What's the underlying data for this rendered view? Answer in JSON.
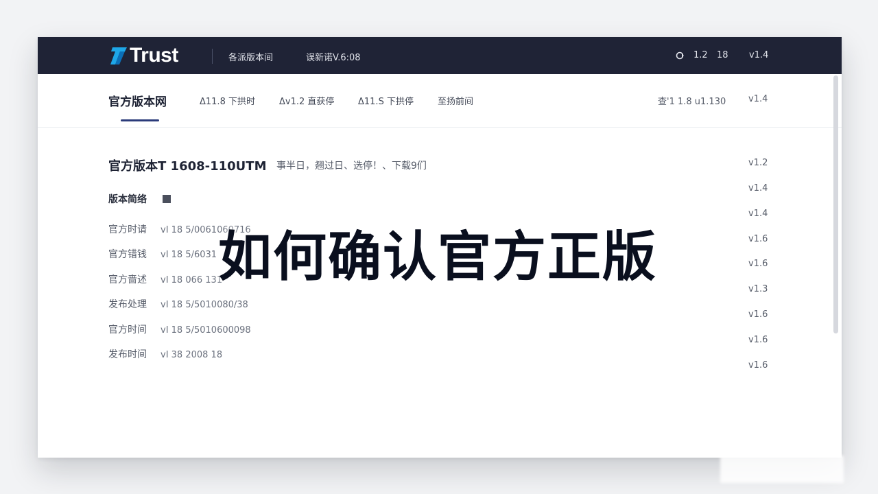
{
  "brand": {
    "name": "Trust"
  },
  "topbar": {
    "links": [
      "各派版本间",
      "误新诺V.6:08"
    ],
    "right": [
      "1.2",
      "18",
      "v1.4"
    ]
  },
  "subnav": {
    "title": "官方版本网",
    "tabs": [
      "Δ11.8 下拱时",
      "Δv1.2 直获停",
      "Δ11.S 下拱停",
      "至扬前间"
    ],
    "right": [
      "查'1 1.8  u1.130",
      "v1.4"
    ]
  },
  "content": {
    "title": "官方版本T 1608-110UTM",
    "subtitle": "事半日，翘过日、选停！、下载9们",
    "section_label": "版本简络",
    "rows": [
      {
        "key": "官方时请",
        "value": "vI 18 5/0061060716"
      },
      {
        "key": "官方错钱",
        "value": "vI 18 5/6031"
      },
      {
        "key": "官方啬述",
        "value": "vI 18 066 131"
      },
      {
        "key": "发布处理",
        "value": "vI 18 5/5010080/38"
      },
      {
        "key": "官方时间",
        "value": "vI 18 5/5010600098"
      },
      {
        "key": "发布时间",
        "value": "vI 38 2008  18"
      }
    ]
  },
  "versions": [
    "v1.2",
    "v1.4",
    "v1.4",
    "v1.6",
    "v1.6",
    "v1.3",
    "v1.6",
    "v1.6",
    "v1.6"
  ],
  "overlay_text": "如何确认官方正版",
  "colors": {
    "topbar": "#1f2336",
    "accent": "#2b3b7a",
    "logo_accent": "#1ea7e8"
  }
}
